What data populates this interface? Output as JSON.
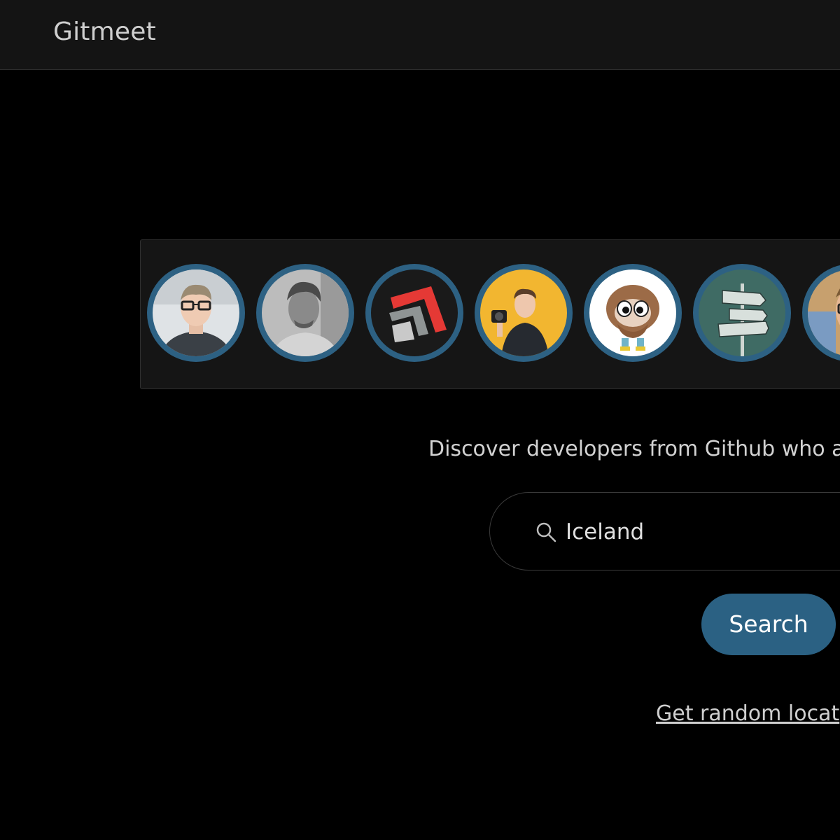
{
  "header": {
    "brand": "Gitmeet"
  },
  "avatars": [
    {
      "name": "developer-avatar-1"
    },
    {
      "name": "developer-avatar-2"
    },
    {
      "name": "developer-avatar-3"
    },
    {
      "name": "developer-avatar-4"
    },
    {
      "name": "developer-avatar-5"
    },
    {
      "name": "developer-avatar-6"
    },
    {
      "name": "developer-avatar-7"
    }
  ],
  "main": {
    "tagline": "Discover developers from Github who a",
    "search": {
      "value": "Iceland",
      "icon": "search-icon"
    },
    "search_button_label": "Search",
    "random_link": "Get random locat"
  },
  "colors": {
    "accent": "#2b6183",
    "background": "#000000",
    "header_bg": "#141414"
  }
}
